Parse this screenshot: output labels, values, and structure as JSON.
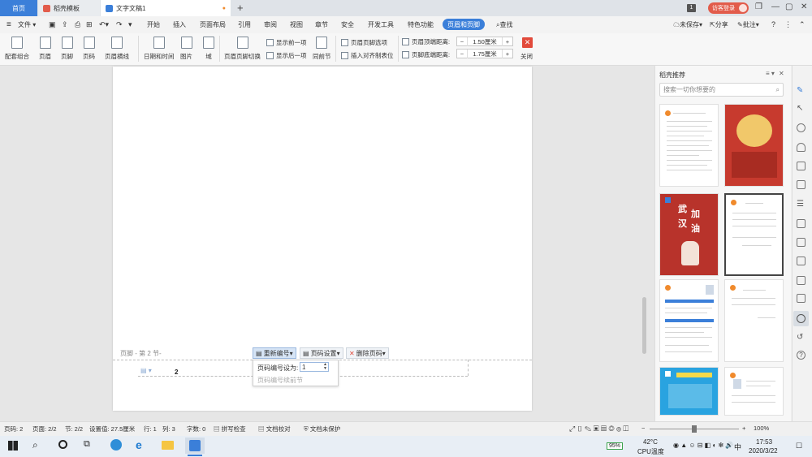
{
  "titlebar": {
    "tabs": [
      {
        "label": "首页",
        "active": true
      },
      {
        "label": "稻壳模板"
      },
      {
        "label": "文字文稿1"
      }
    ],
    "page_count_badge": "1",
    "visitor_label": "访客登录"
  },
  "menubar": {
    "file_label": "文件",
    "items": [
      "开始",
      "插入",
      "页面布局",
      "引用",
      "审阅",
      "视图",
      "章节",
      "安全",
      "开发工具",
      "特色功能",
      "页眉和页脚"
    ],
    "search_label": "查找",
    "unsaved_label": "未保存",
    "share_label": "分享",
    "comment_label": "批注"
  },
  "ribbon": {
    "buttons": [
      "配套组合",
      "页眉",
      "页脚",
      "页码",
      "页眉横线",
      "日期和时间",
      "图片",
      "域",
      "页眉页脚切换",
      "同前节",
      "关闭"
    ],
    "show_prev": "显示前一项",
    "show_next": "显示后一项",
    "hf_options": "页眉页脚选项",
    "insert_align_tab": "插入对齐制表位",
    "header_top_label": "页眉顶端距离:",
    "header_top_value": "1.50厘米",
    "footer_bottom_label": "页脚底端距离:",
    "footer_bottom_value": "1.75厘米"
  },
  "document": {
    "footer_label": "页脚 - 第 2 节-",
    "renumber_label": "重新编号",
    "pagenum_settings_label": "页码设置",
    "delete_pagenum_label": "删除页码",
    "page_number": "2",
    "popup": {
      "set_label": "页码编号设为:",
      "set_value": "1",
      "continue_label": "页码编号续前节"
    }
  },
  "panel": {
    "title": "稻壳推荐",
    "search_placeholder": "搜索一切你想要的",
    "thumb_texts": [
      "武",
      "加",
      "汉",
      "油"
    ]
  },
  "statusbar": {
    "page": "页码: 2",
    "pages": "页面: 2/2",
    "section": "节: 2/2",
    "setting": "设置值: 27.5厘米",
    "row": "行: 1",
    "col": "列: 3",
    "words": "字数: 0",
    "spell": "拼写检查",
    "proof": "文档校对",
    "protect": "文档未保护",
    "zoom": "100%"
  },
  "taskbar": {
    "temp": "42°C",
    "temp_label": "CPU温度",
    "battery": "95%",
    "ime": "中",
    "time": "17:53",
    "date": "2020/3/22"
  },
  "colors": {
    "accent_blue": "#3b7fd9",
    "close_red": "#e24a3b",
    "poster_red": "#c73a2e"
  }
}
